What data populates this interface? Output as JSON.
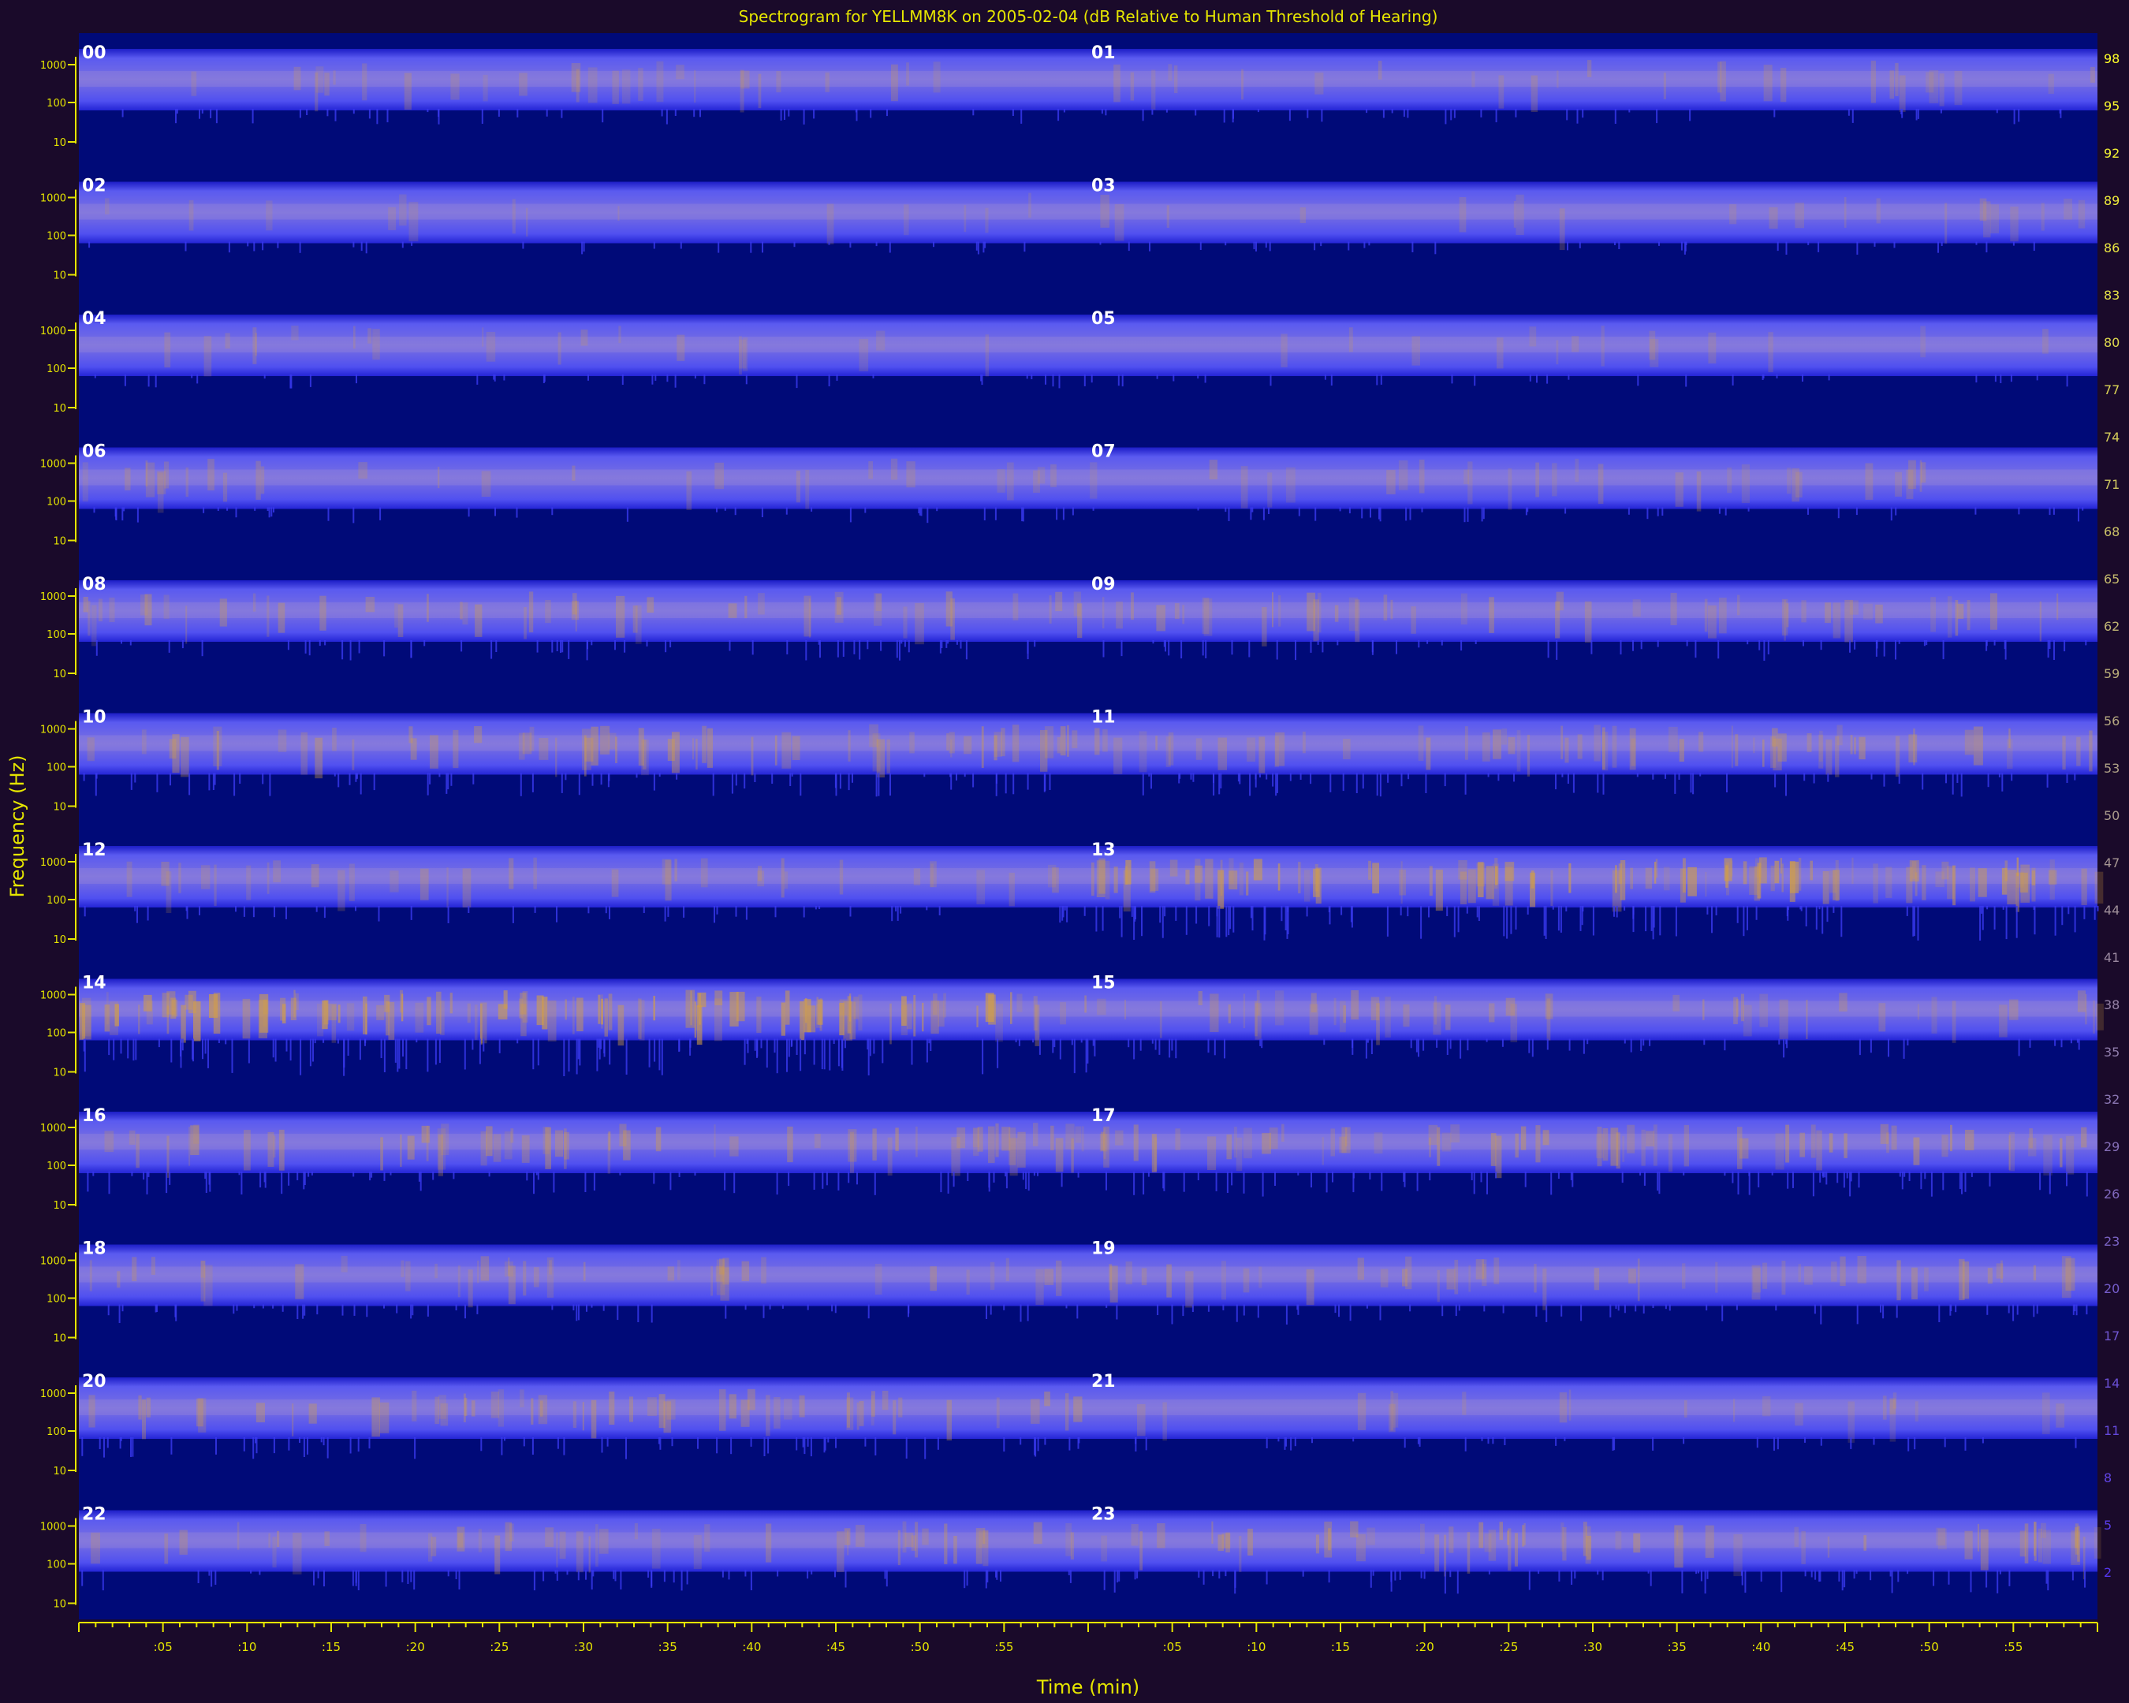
{
  "chart_data": {
    "type": "heatmap",
    "title": "Spectrogram for YELLMM8K on 2005-02-04 (dB Relative to Human Threshold of Hearing)",
    "xlabel": "Time (min)",
    "ylabel": "Frequency (Hz)",
    "x_tick_labels": [
      ":05",
      ":10",
      ":15",
      ":20",
      ":25",
      ":30",
      ":35",
      ":40",
      ":45",
      ":50",
      ":55"
    ],
    "y_tick_labels": [
      "1000",
      "100",
      "10"
    ],
    "row_labels": [
      [
        "00",
        "01"
      ],
      [
        "02",
        "03"
      ],
      [
        "04",
        "05"
      ],
      [
        "06",
        "07"
      ],
      [
        "08",
        "09"
      ],
      [
        "10",
        "11"
      ],
      [
        "12",
        "13"
      ],
      [
        "14",
        "15"
      ],
      [
        "16",
        "17"
      ],
      [
        "18",
        "19"
      ],
      [
        "20",
        "21"
      ],
      [
        "22",
        "23"
      ]
    ],
    "colorbar_labels": [
      98,
      95,
      92,
      89,
      86,
      83,
      80,
      77,
      74,
      71,
      68,
      65,
      62,
      59,
      56,
      53,
      50,
      47,
      44,
      41,
      38,
      35,
      32,
      29,
      26,
      23,
      20,
      17,
      14,
      11,
      8,
      5,
      2
    ],
    "hour_intensity": [
      0.2,
      0.2,
      0.1,
      0.15,
      0.15,
      0.1,
      0.2,
      0.2,
      0.35,
      0.35,
      0.45,
      0.45,
      0.25,
      0.8,
      0.9,
      0.35,
      0.45,
      0.5,
      0.3,
      0.35,
      0.4,
      0.15,
      0.35,
      0.45
    ],
    "colors": {
      "background": "#1a0a2a",
      "plot_background": "#000a78",
      "band": "#3a3ae6",
      "hot": "#d6a040",
      "axis": "#e6e600",
      "text": "#ffffff"
    }
  }
}
